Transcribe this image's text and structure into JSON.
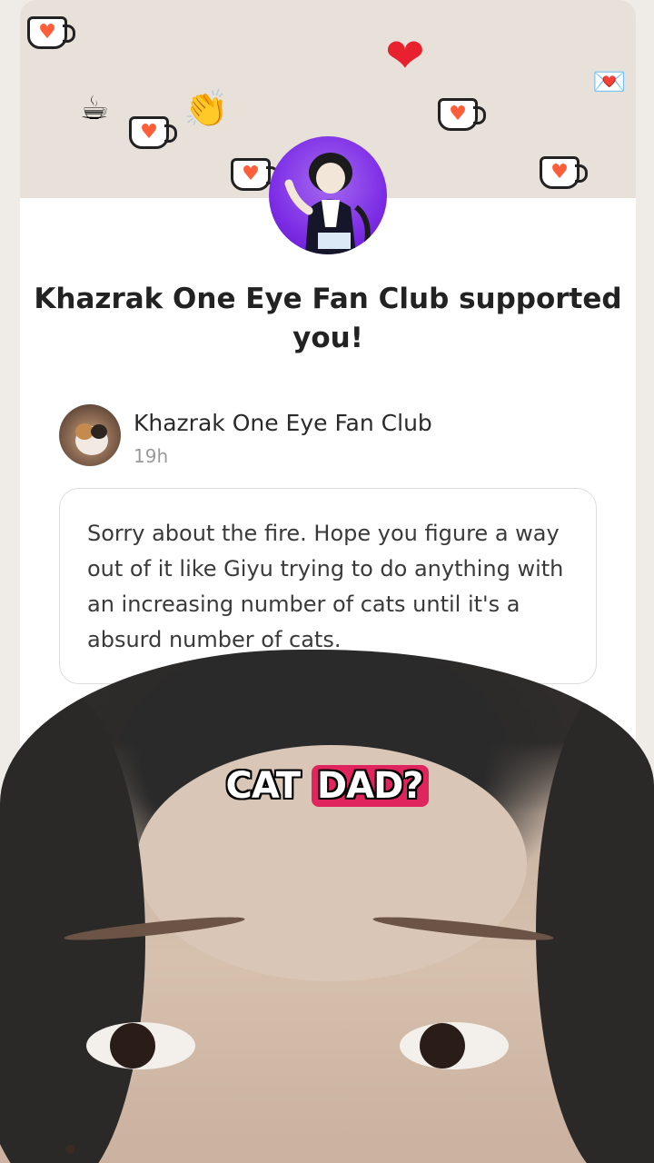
{
  "notification": {
    "title": "Khazrak One Eye Fan Club supported you!"
  },
  "supporter": {
    "name": "Khazrak One Eye Fan Club",
    "time": "19h",
    "message": "Sorry about the fire. Hope you figure a way out of it like Giyu trying to do anything with an increasing number of cats until it's a absurd number of cats."
  },
  "caption": {
    "word1": "CAT",
    "word2": "DAD?"
  },
  "decorations": {
    "cup_icon": "kofi-cup-icon",
    "heart_glyph": "♥",
    "big_heart": "❤",
    "coffee": "☕",
    "clap": "👏",
    "letter": "💌"
  },
  "colors": {
    "banner": "#e7e1da",
    "highlight": "#e0245e",
    "heart": "#ff5e3a"
  }
}
